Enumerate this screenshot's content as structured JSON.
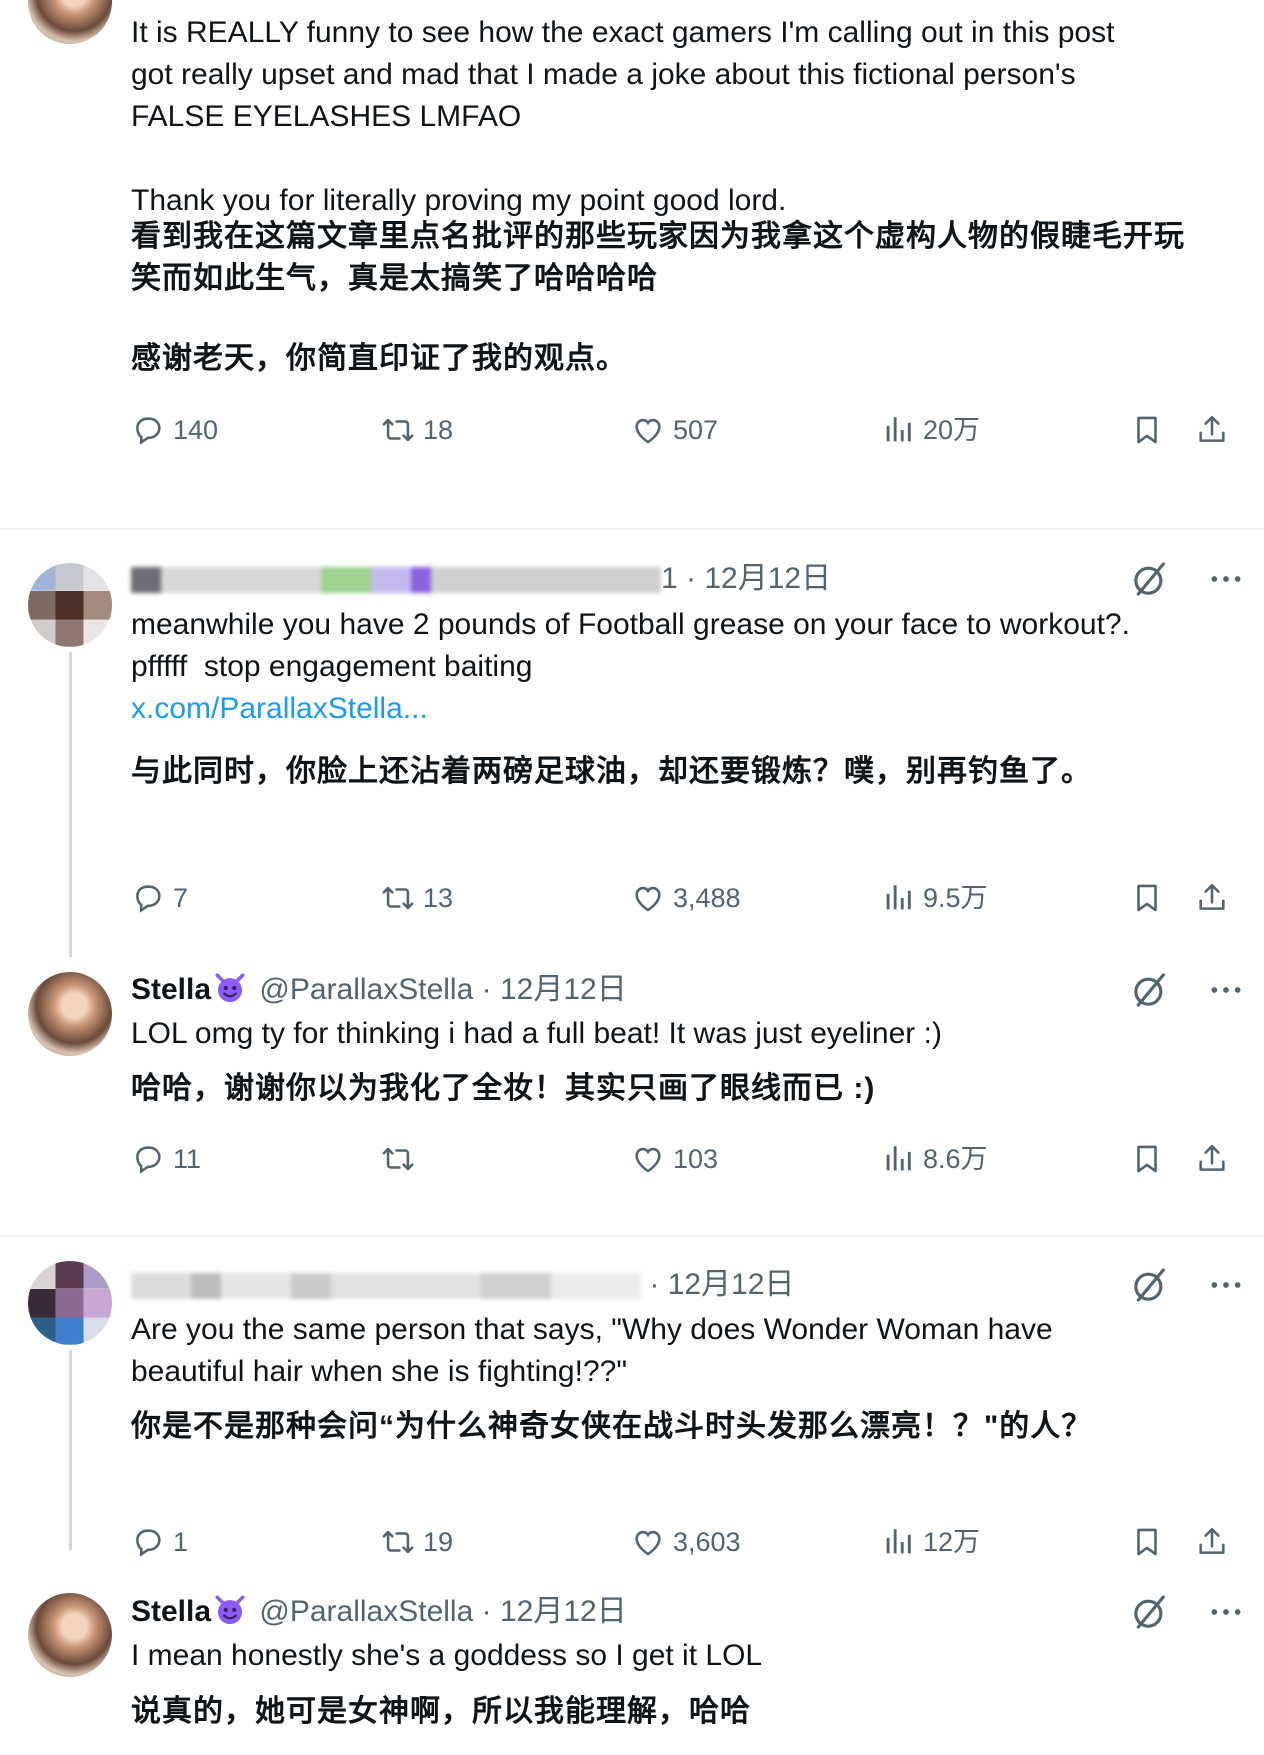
{
  "tweets": [
    {
      "text_en": [
        "It is REALLY funny to see how the exact gamers I'm calling out in this post",
        "got really upset and mad that I made a joke about this fictional person's",
        "FALSE EYELASHES LMFAO",
        "",
        "Thank you for literally proving my point good lord."
      ],
      "text_zh": [
        "看到我在这篇文章里点名批评的那些玩家因为我拿这个虚构人物的假睫毛开玩",
        "笑而如此生气，真是太搞笑了哈哈哈哈",
        "",
        "感谢老天，你简直印证了我的观点。"
      ],
      "replies": "140",
      "retweets": "18",
      "likes": "507",
      "views": "20万"
    },
    {
      "handle_tail": "1",
      "dot": "·",
      "date": "12月12日",
      "text_en": [
        "meanwhile you have 2 pounds of Football grease on your face to workout?.",
        "pfffff  stop engagement baiting"
      ],
      "link": "x.com/ParallaxStella...",
      "text_zh": [
        "与此同时，你脸上还沾着两磅足球油，却还要锻炼？噗，别再钓鱼了。"
      ],
      "replies": "7",
      "retweets": "13",
      "likes": "3,488",
      "views": "9.5万"
    },
    {
      "name": "Stella",
      "handle": "@ParallaxStella",
      "dot": "·",
      "date": "12月12日",
      "text_en": [
        "LOL omg ty for thinking i had a full beat! It was just eyeliner :)"
      ],
      "text_zh": [
        "哈哈，谢谢你以为我化了全妆！其实只画了眼线而已 :)"
      ],
      "replies": "11",
      "retweets": "",
      "likes": "103",
      "views": "8.6万"
    },
    {
      "dot": "·",
      "date": "12月12日",
      "text_en": [
        "Are you the same person that says, \"Why does Wonder Woman have",
        "beautiful hair when she is fighting!??\""
      ],
      "text_zh": [
        "你是不是那种会问“为什么神奇女侠在战斗时头发那么漂亮！？\"的人？"
      ],
      "replies": "1",
      "retweets": "19",
      "likes": "3,603",
      "views": "12万"
    },
    {
      "name": "Stella",
      "handle": "@ParallaxStella",
      "dot": "·",
      "date": "12月12日",
      "text_en": [
        "I mean honestly she's a goddess so I get it LOL"
      ],
      "text_zh": [
        "说真的，她可是女神啊，所以我能理解，哈哈"
      ]
    }
  ],
  "colors": {
    "text": "#0f1419",
    "secondary": "#536471",
    "link": "#1d9bf0",
    "divider": "#eff3f4"
  },
  "icons": [
    "reply-icon",
    "retweet-icon",
    "like-icon",
    "views-icon",
    "bookmark-icon",
    "share-icon",
    "grok-icon",
    "more-icon",
    "devil-emoji-icon"
  ]
}
